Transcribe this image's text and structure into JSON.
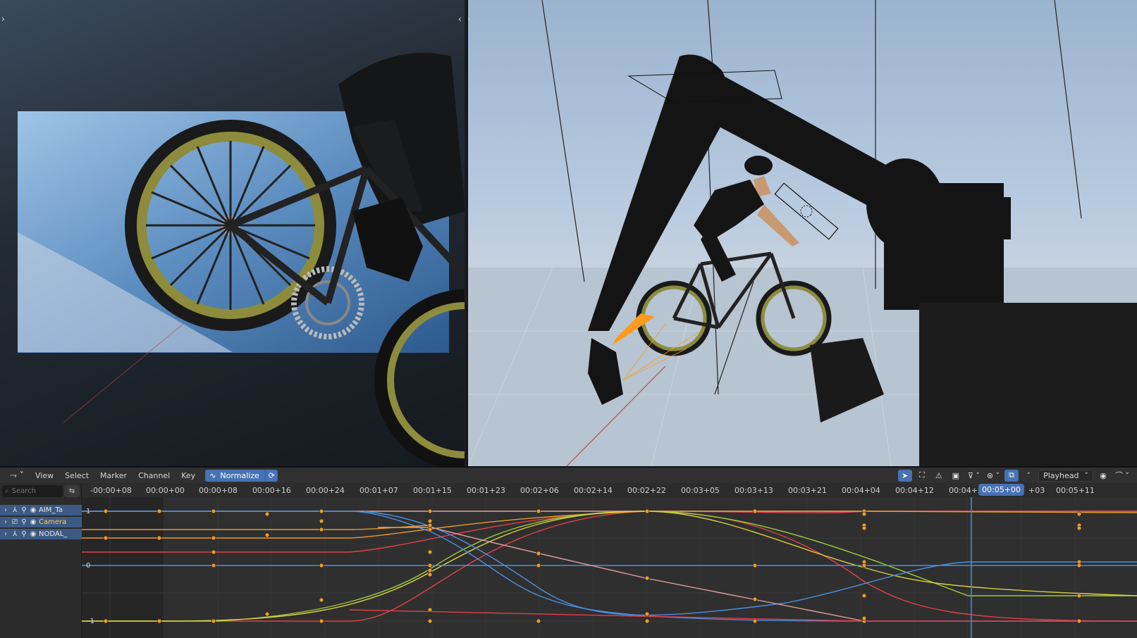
{
  "editor": {
    "type_icon": "graph-editor-icon",
    "menus": [
      "View",
      "Select",
      "Marker",
      "Channel",
      "Key"
    ],
    "normalize_label": "Normalize",
    "playhead_mode": "Playhead"
  },
  "channels": {
    "search_placeholder": "Search",
    "items": [
      {
        "label": "AIM_Ta",
        "kind": "armature-icon",
        "active": false
      },
      {
        "label": "Camera",
        "kind": "camera-icon",
        "active": true
      },
      {
        "label": "NODAL_",
        "kind": "armature-icon",
        "active": false
      }
    ]
  },
  "timeline": {
    "ticks": [
      "-00:00+08",
      "00:00+00",
      "00:00+08",
      "00:00+16",
      "00:00+24",
      "00:01+07",
      "00:01+15",
      "00:01+23",
      "00:02+06",
      "00:02+14",
      "00:02+22",
      "00:03+05",
      "00:03+13",
      "00:03+21",
      "00:04+04",
      "00:04+12",
      "00:04+2",
      "+03",
      "00:05+11"
    ],
    "current_time": "00:05+00"
  },
  "graph": {
    "axis_values": [
      "1",
      "0",
      "-1"
    ]
  },
  "colors": {
    "accent": "#4772b3",
    "curve_red": "#e0404a",
    "curve_orange": "#e89a2c",
    "curve_yellow": "#d8d040",
    "curve_green": "#9ccc3a",
    "curve_blue": "#4a8fe0",
    "curve_pink": "#e0a0a0",
    "camera_marker": "#ff9a1a"
  }
}
